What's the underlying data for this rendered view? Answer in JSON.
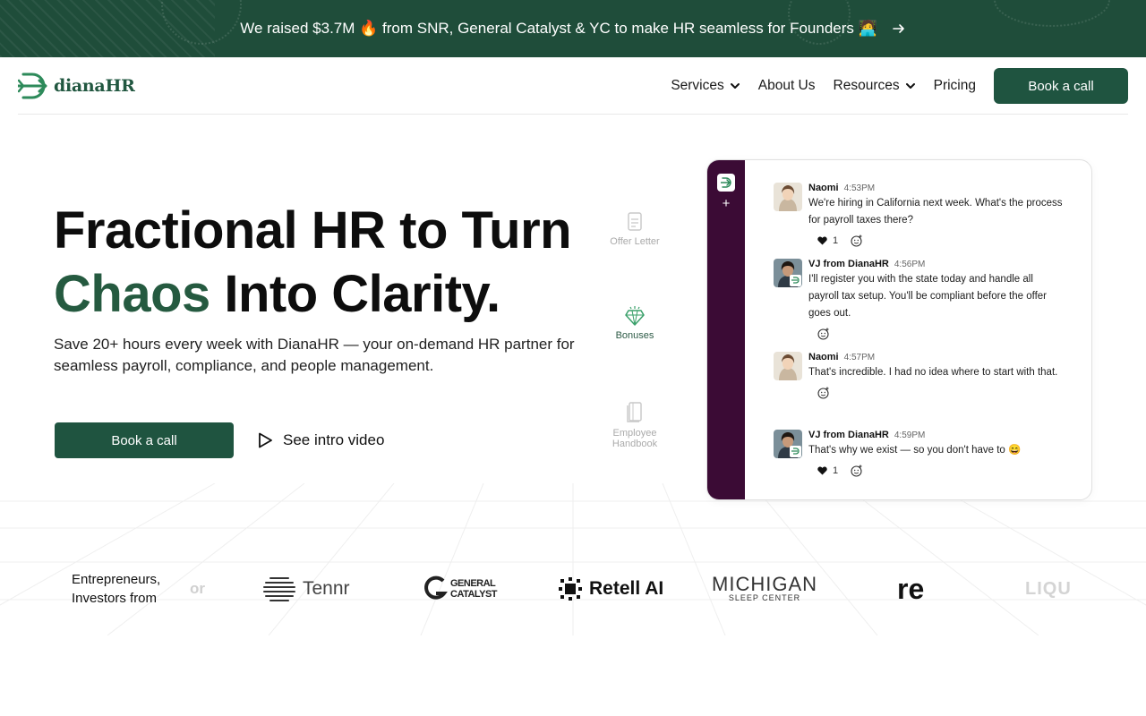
{
  "banner": {
    "text": "We raised $3.7M 🔥 from SNR, General Catalyst & YC to make HR seamless for Founders 🧑‍💻"
  },
  "nav": {
    "logo_text": "dianaHR",
    "links": [
      {
        "label": "Services",
        "has_dropdown": true
      },
      {
        "label": "About Us",
        "has_dropdown": false
      },
      {
        "label": "Resources",
        "has_dropdown": true
      },
      {
        "label": "Pricing",
        "has_dropdown": false
      }
    ],
    "cta_label": "Book a call"
  },
  "hero": {
    "title_line1": "Fractional HR to Turn",
    "title_accent": "Chaos",
    "title_line2_rest": " Into Clarity.",
    "subtitle": "Save 20+ hours every week with DianaHR — your on-demand HR partner for seamless payroll, compliance, and people management.",
    "cta_label": "Book a call",
    "video_label": "See intro video"
  },
  "features": [
    {
      "label": "Offer Letter",
      "icon": "document-icon",
      "active": false
    },
    {
      "label": "Bonuses",
      "icon": "diamond-icon",
      "active": true
    },
    {
      "label": "Employee Handbook",
      "icon": "book-icon",
      "active": false
    }
  ],
  "chat": {
    "messages": [
      {
        "name": "Naomi",
        "time": "4:53PM",
        "text": "We're hiring in California next week. What's the process for payroll taxes there?",
        "likes": "1"
      },
      {
        "name": "VJ from DianaHR",
        "time": "4:56PM",
        "text": "I'll register you with the state today and handle all payroll tax setup. You'll be compliant before the offer goes out.",
        "likes": null
      },
      {
        "name": "Naomi",
        "time": "4:57PM",
        "text": "That's incredible. I had no idea where to start with that.",
        "likes": null
      },
      {
        "name": "VJ from DianaHR",
        "time": "4:59PM",
        "text": "That's why we exist — so you don't have to 😄",
        "likes": "1"
      }
    ]
  },
  "logos": {
    "label": "Entrepreneurs, Investors from",
    "items": [
      {
        "name": "or"
      },
      {
        "name": "Tennr"
      },
      {
        "name": "GENERAL CATALYST"
      },
      {
        "name": "Retell AI"
      },
      {
        "name": "MICHIGAN",
        "sub": "SLEEP CENTER"
      },
      {
        "name": "re"
      },
      {
        "name": "LIQU"
      }
    ]
  },
  "colors": {
    "brand_green": "#1f5440",
    "accent_green": "#255a40",
    "slack_purple": "#3b0b35"
  }
}
